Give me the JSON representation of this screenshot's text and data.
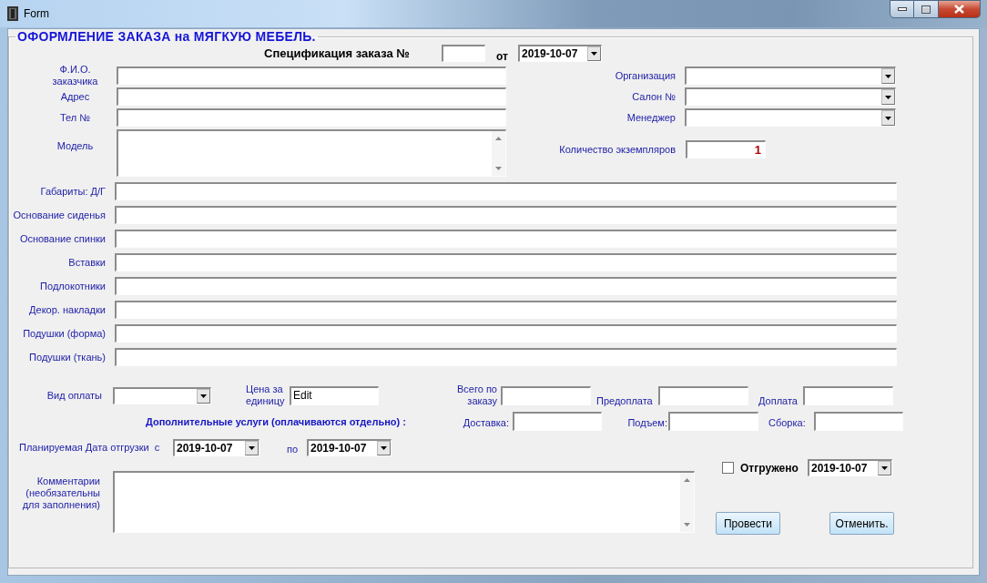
{
  "window": {
    "title": "Form"
  },
  "group": {
    "title": "ОФОРМЛЕНИЕ ЗАКАЗА на МЯГКУЮ МЕБЕЛЬ."
  },
  "spec": {
    "label": "Спецификация заказа №",
    "date_label": "от",
    "date": "2019-10-07"
  },
  "customer_fields": [
    {
      "label": "Ф.И.О. заказчика",
      "kind": "text"
    },
    {
      "label": "Адрес",
      "kind": "text"
    },
    {
      "label": "Тел №",
      "kind": "text"
    },
    {
      "label": "Модель",
      "kind": "memo"
    }
  ],
  "order_fields": [
    {
      "label": "Организация",
      "kind": "combo"
    },
    {
      "label": "Салон №",
      "kind": "combo"
    },
    {
      "label": "Менеджер",
      "kind": "combo"
    }
  ],
  "quantity": {
    "label": "Количество экземпляров",
    "value": "1"
  },
  "spec_fields": [
    {
      "label": "Габариты: Д/Г"
    },
    {
      "label": "Основание сиденья"
    },
    {
      "label": "Основание спинки"
    },
    {
      "label": "Вставки"
    },
    {
      "label": "Подлокотники"
    },
    {
      "label": "Декор. накладки"
    },
    {
      "label": "Подушки (форма)"
    },
    {
      "label": "Подушки (ткань)"
    }
  ],
  "payment": {
    "label": "Вид оплаты"
  },
  "price": {
    "label": "Цена за единицу",
    "value": "Edit"
  },
  "totals": [
    {
      "label": "Всего по заказу"
    },
    {
      "label": "Предоплата"
    },
    {
      "label": "Доплата"
    }
  ],
  "services": {
    "title": "Дополнительные услуги (оплачиваются отдельно) :",
    "fields": [
      {
        "label": "Доставка:"
      },
      {
        "label": "Подъем:"
      },
      {
        "label": "Сборка:"
      }
    ]
  },
  "shipping": {
    "label": "Планируемая Дата отгрузки  с",
    "from": "2019-10-07",
    "to_label": "по",
    "to": "2019-10-07"
  },
  "comments": {
    "label": "Комментарии (необязательны для заполнения)"
  },
  "shipped": {
    "label": "Отгружено",
    "checked": false,
    "date": "2019-10-07"
  },
  "buttons": [
    {
      "label": "Провести"
    },
    {
      "label": "Отменить."
    }
  ]
}
